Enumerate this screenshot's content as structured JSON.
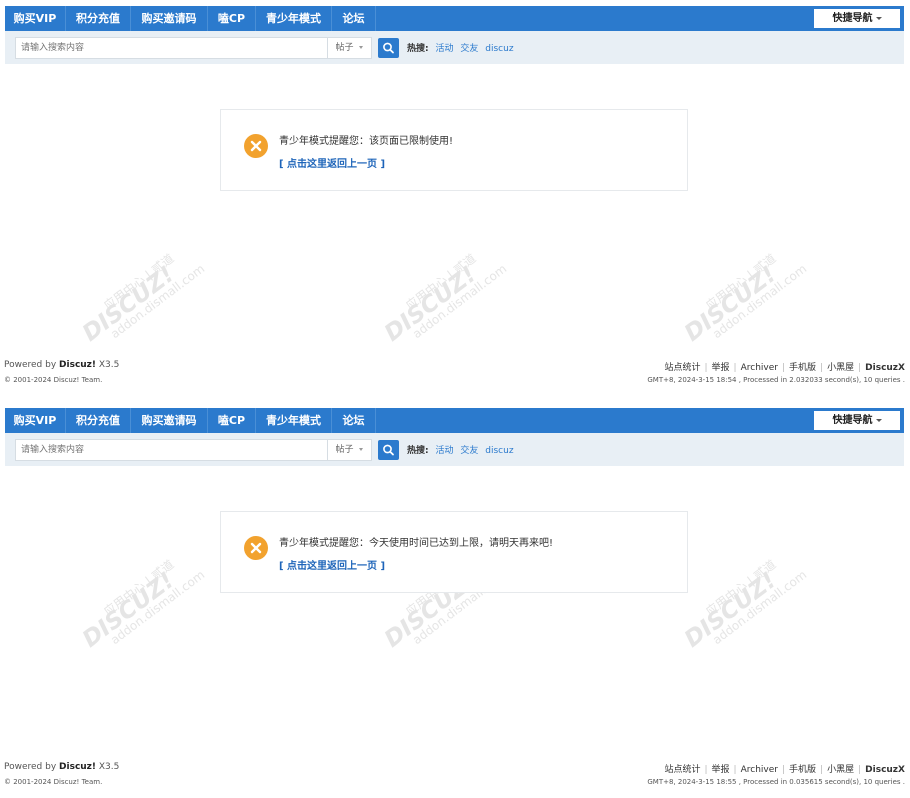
{
  "nav": {
    "items": [
      "购买VIP",
      "积分充值",
      "购买邀请码",
      "嗑CP",
      "青少年模式",
      "论坛"
    ],
    "quick_nav": "快捷导航"
  },
  "search": {
    "placeholder": "请输入搜索内容",
    "type": "帖子",
    "hot_label": "热搜:",
    "hot_links": [
      "活动",
      "交友",
      "discuz"
    ]
  },
  "watermark": {
    "logo": "DISCUZ!",
    "line1": "应用中心 | 贰道",
    "line2": "addon.dismall.com"
  },
  "panels": [
    {
      "message": "青少年模式提醒您：该页面已限制使用!",
      "back_link": "[ 点击这里返回上一页 ]",
      "footer_time": "GMT+8, 2024-3-15 18:54 , Processed in 2.032033 second(s), 10 queries ."
    },
    {
      "message": "青少年模式提醒您：今天使用时间已达到上限，请明天再来吧!",
      "back_link": "[ 点击这里返回上一页 ]",
      "footer_time": "GMT+8, 2024-3-15 18:55 , Processed in 0.035615 second(s), 10 queries ."
    }
  ],
  "footer": {
    "powered_prefix": "Powered by ",
    "powered_name": "Discuz!",
    "powered_version": " X3.5",
    "copyright": "© 2001-2024 Discuz! Team.",
    "links": [
      "站点统计",
      "举报",
      "Archiver",
      "手机版",
      "小黑屋"
    ],
    "brand": "DiscuzX"
  },
  "colors": {
    "nav_bg": "#2b7acd",
    "search_bg": "#e8eff5",
    "warning_icon": "#f2a22e",
    "link": "#2b7acd"
  }
}
